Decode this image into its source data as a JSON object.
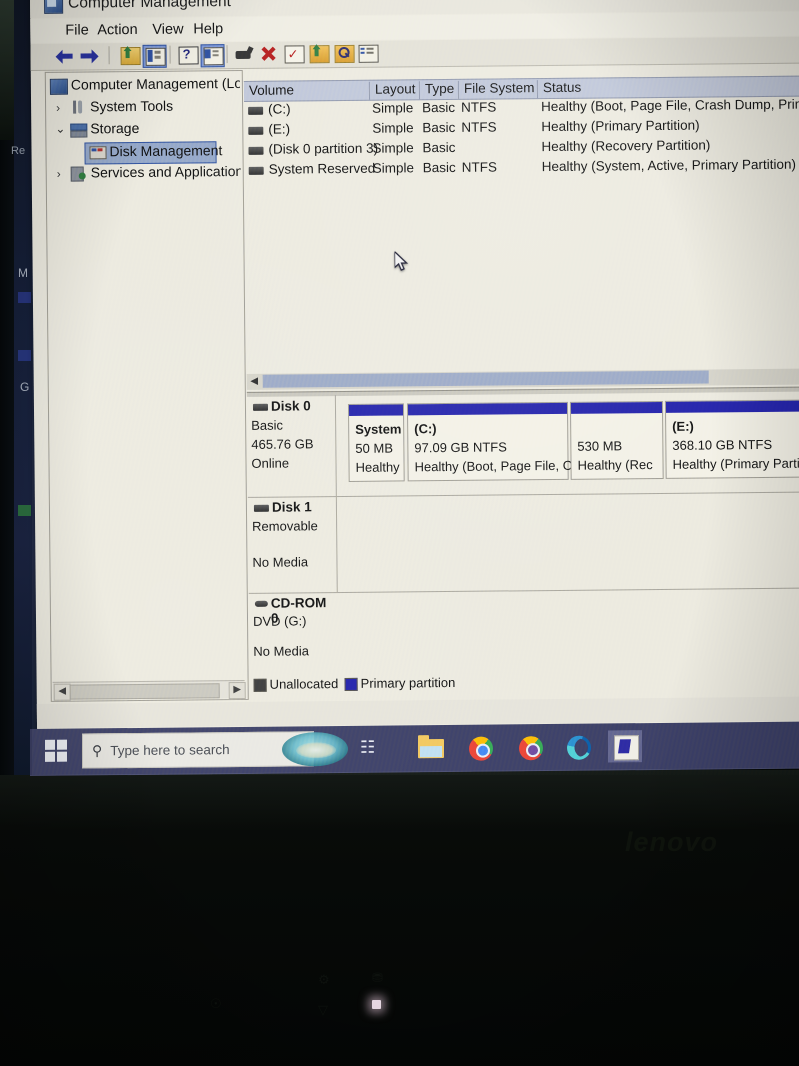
{
  "window": {
    "title": "Computer Management",
    "title_icon": "computer-management-icon",
    "menus": [
      "File",
      "Action",
      "View",
      "Help"
    ],
    "toolbar_icons": [
      "back-arrow-icon",
      "forward-arrow-icon",
      "up-folder-icon",
      "show-hide-console-tree-icon",
      "help-icon",
      "show-hide-action-pane-icon",
      "properties-icon",
      "delete-icon",
      "refresh-icon",
      "export-list-icon",
      "search-icon",
      "view-icon"
    ]
  },
  "tree": {
    "root": {
      "label": "Computer Management (Local",
      "icon": "computer-icon"
    },
    "items": [
      {
        "label": "System Tools",
        "icon": "system-tools-icon",
        "expander": "›",
        "selected": false,
        "indent": 1
      },
      {
        "label": "Storage",
        "icon": "storage-icon",
        "expander": "⌄",
        "selected": false,
        "indent": 1
      },
      {
        "label": "Disk Management",
        "icon": "disk-management-icon",
        "expander": "",
        "selected": true,
        "indent": 2
      },
      {
        "label": "Services and Applications",
        "icon": "services-icon",
        "expander": "›",
        "selected": false,
        "indent": 1
      }
    ]
  },
  "volume_list": {
    "columns": [
      "Volume",
      "Layout",
      "Type",
      "File System",
      "Status"
    ],
    "rows": [
      {
        "volume": "(C:)",
        "layout": "Simple",
        "type": "Basic",
        "filesystem": "NTFS",
        "status": "Healthy (Boot, Page File, Crash Dump, Primary"
      },
      {
        "volume": "(E:)",
        "layout": "Simple",
        "type": "Basic",
        "filesystem": "NTFS",
        "status": "Healthy (Primary Partition)"
      },
      {
        "volume": "(Disk 0 partition 3)",
        "layout": "Simple",
        "type": "Basic",
        "filesystem": "",
        "status": "Healthy (Recovery Partition)"
      },
      {
        "volume": "System Reserved",
        "layout": "Simple",
        "type": "Basic",
        "filesystem": "NTFS",
        "status": "Healthy (System, Active, Primary Partition)"
      }
    ]
  },
  "disk_view": {
    "disks": [
      {
        "name": "Disk 0",
        "lines": [
          "Basic",
          "465.76 GB",
          "Online"
        ],
        "partitions": [
          {
            "label": "System",
            "size": "50 MB",
            "status": "Healthy",
            "kind": "primary"
          },
          {
            "label": "(C:)",
            "size": "97.09 GB NTFS",
            "status": "Healthy (Boot, Page File, C",
            "kind": "primary"
          },
          {
            "label": "",
            "size": "530 MB",
            "status": "Healthy (Rec",
            "kind": "primary"
          },
          {
            "label": "(E:)",
            "size": "368.10 GB NTFS",
            "status": "Healthy (Primary Partition)",
            "kind": "primary"
          }
        ]
      },
      {
        "name": "Disk 1",
        "lines": [
          "Removable",
          "",
          "No Media"
        ],
        "partitions": []
      },
      {
        "name": "CD-ROM 0",
        "lines": [
          "DVD (G:)",
          "",
          "No Media"
        ],
        "partitions": []
      }
    ]
  },
  "legend": [
    {
      "label": "Unallocated",
      "color": "#3a3a3a"
    },
    {
      "label": "Primary partition",
      "color": "#2221a8"
    }
  ],
  "taskbar": {
    "start_icon": "windows-start-icon",
    "search_placeholder": "Type here to search",
    "search_icon": "search-icon",
    "cortana_icon": "cortana-icon",
    "task_view_icon": "task-view-icon",
    "pinned": [
      {
        "name": "file-explorer-icon"
      },
      {
        "name": "google-chrome-icon"
      },
      {
        "name": "google-chrome-icon"
      },
      {
        "name": "microsoft-edge-icon"
      },
      {
        "name": "app-window-icon"
      }
    ]
  },
  "desktop": {
    "partial_label": "Re"
  },
  "device": {
    "brand": "lenovo"
  },
  "colors": {
    "partition_bar": "#2221a8",
    "selection": "#7b96d8",
    "header": "#bfc6d8",
    "window_bg": "#eceadf",
    "taskbar": "#3c3f64"
  }
}
